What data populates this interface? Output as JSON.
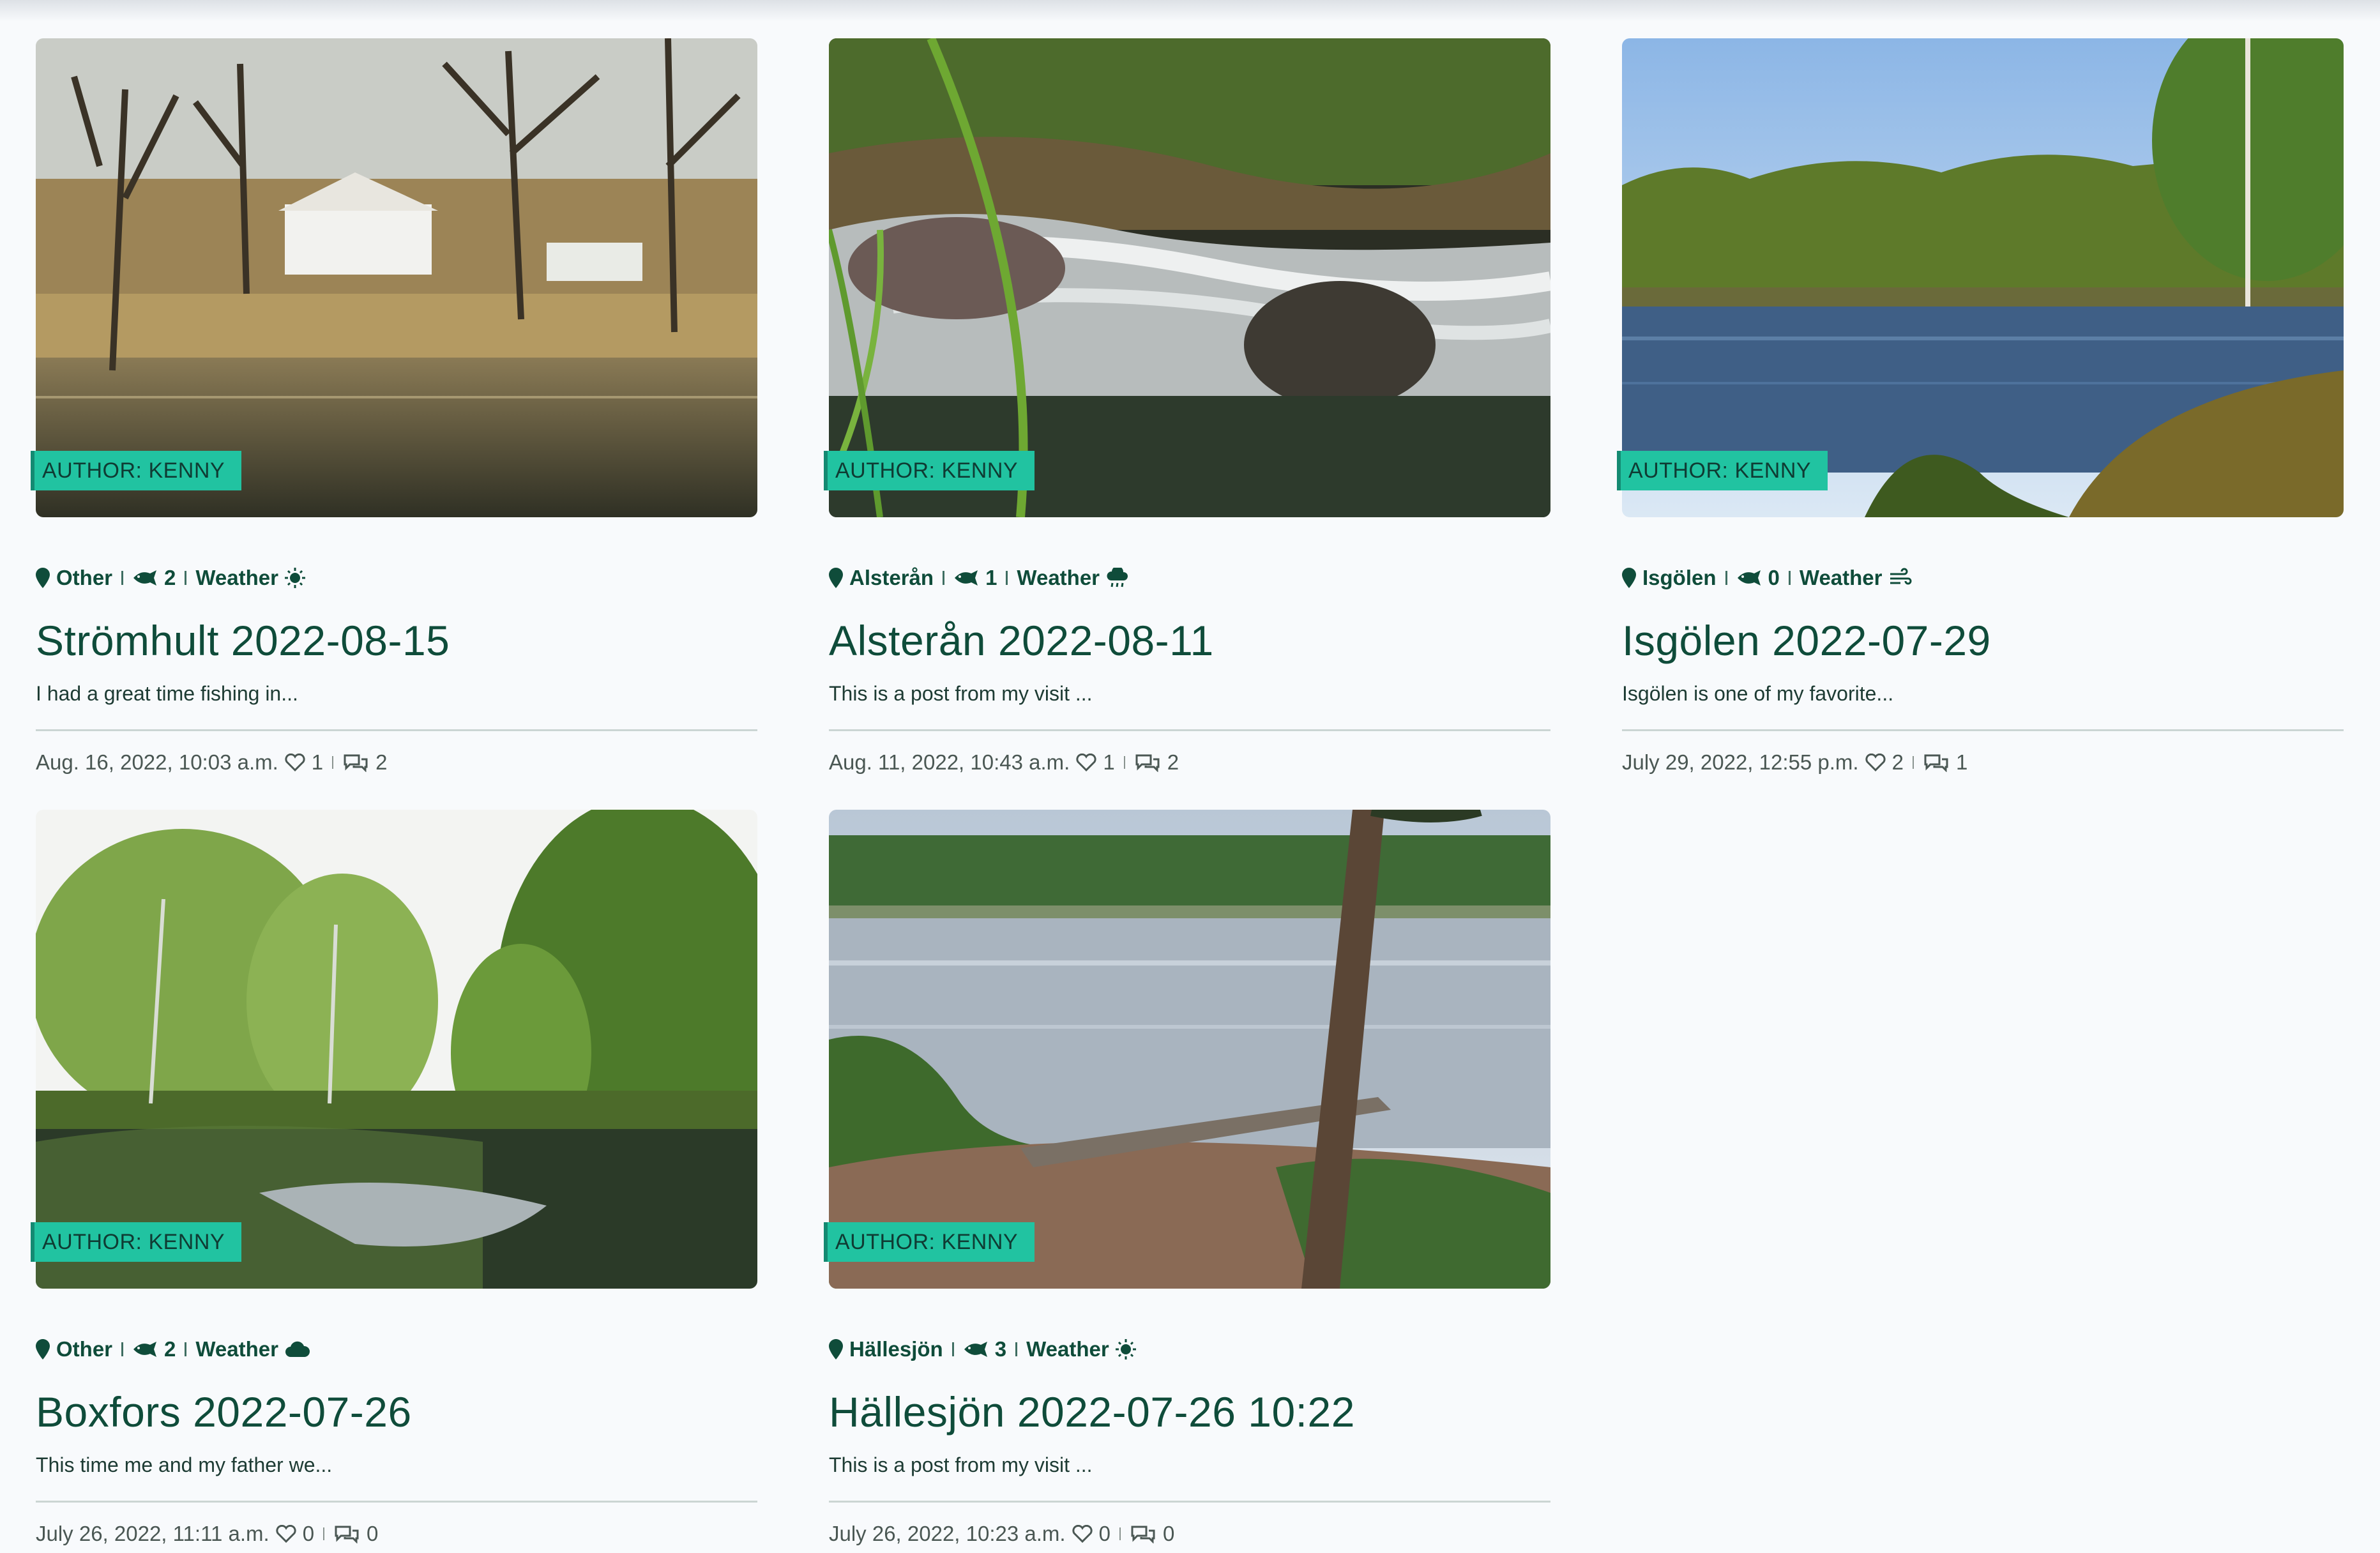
{
  "posts": [
    {
      "author": "AUTHOR: KENNY",
      "location": "Other",
      "fish_count": "2",
      "weather_label": "Weather",
      "weather_icon": "sun-icon",
      "title": "Strömhult 2022-08-15",
      "excerpt": "I had a great time fishing in...",
      "date": "Aug. 16, 2022, 10:03 a.m.",
      "likes": "1",
      "comments": "2"
    },
    {
      "author": "AUTHOR: KENNY",
      "location": "Alsterån",
      "fish_count": "1",
      "weather_label": "Weather",
      "weather_icon": "cloud-rain-icon",
      "title": "Alsterån 2022-08-11",
      "excerpt": "This is a post from my visit ...",
      "date": "Aug. 11, 2022, 10:43 a.m.",
      "likes": "1",
      "comments": "2"
    },
    {
      "author": "AUTHOR: KENNY",
      "location": "Isgölen",
      "fish_count": "0",
      "weather_label": "Weather",
      "weather_icon": "wind-icon",
      "title": "Isgölen 2022-07-29",
      "excerpt": "Isgölen is one of my favorite...",
      "date": "July 29, 2022, 12:55 p.m.",
      "likes": "2",
      "comments": "1"
    },
    {
      "author": "AUTHOR: KENNY",
      "location": "Other",
      "fish_count": "2",
      "weather_label": "Weather",
      "weather_icon": "cloud-icon",
      "title": "Boxfors 2022-07-26",
      "excerpt": "This time me and my father we...",
      "date": "July 26, 2022, 11:11 a.m.",
      "likes": "0",
      "comments": "0"
    },
    {
      "author": "AUTHOR: KENNY",
      "location": "Hällesjön",
      "fish_count": "3",
      "weather_label": "Weather",
      "weather_icon": "sun-icon",
      "title": "Hällesjön 2022-07-26 10:22",
      "excerpt": "This is a post from my visit ...",
      "date": "July 26, 2022, 10:23 a.m.",
      "likes": "0",
      "comments": "0"
    }
  ],
  "colors": {
    "brand_green": "#0f4c3a",
    "author_badge": "#21c3a1",
    "background": "#f8fafc"
  }
}
